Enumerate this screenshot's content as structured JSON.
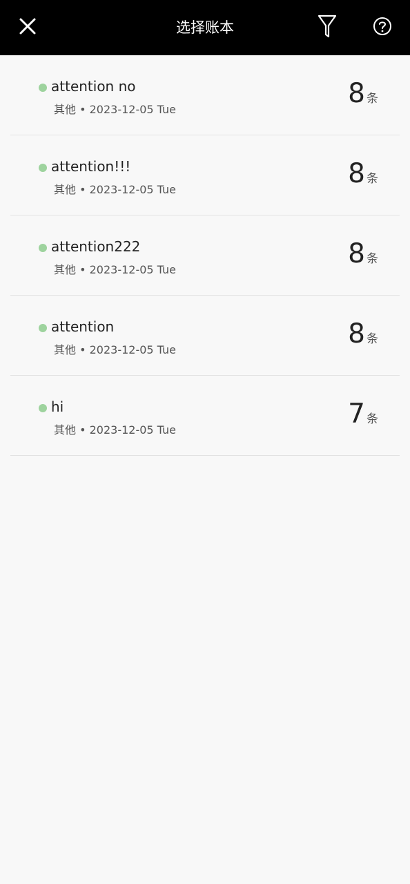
{
  "header": {
    "title": "选择账本",
    "close_icon": "close-icon",
    "filter_icon": "filter-icon",
    "help_icon": "help-icon"
  },
  "colors": {
    "header_bg": "#000000",
    "dot": "#9ed39e"
  },
  "books": [
    {
      "name": "attention no",
      "category": "其他",
      "date": "2023-12-05 Tue",
      "meta": "其他 • 2023-12-05 Tue",
      "count": "8",
      "unit": "条"
    },
    {
      "name": "attention!!!",
      "category": "其他",
      "date": "2023-12-05 Tue",
      "meta": "其他 • 2023-12-05 Tue",
      "count": "8",
      "unit": "条"
    },
    {
      "name": "attention222",
      "category": "其他",
      "date": "2023-12-05 Tue",
      "meta": "其他 • 2023-12-05 Tue",
      "count": "8",
      "unit": "条"
    },
    {
      "name": "attention",
      "category": "其他",
      "date": "2023-12-05 Tue",
      "meta": "其他 • 2023-12-05 Tue",
      "count": "8",
      "unit": "条"
    },
    {
      "name": "hi",
      "category": "其他",
      "date": "2023-12-05 Tue",
      "meta": "其他 • 2023-12-05 Tue",
      "count": "7",
      "unit": "条"
    }
  ]
}
